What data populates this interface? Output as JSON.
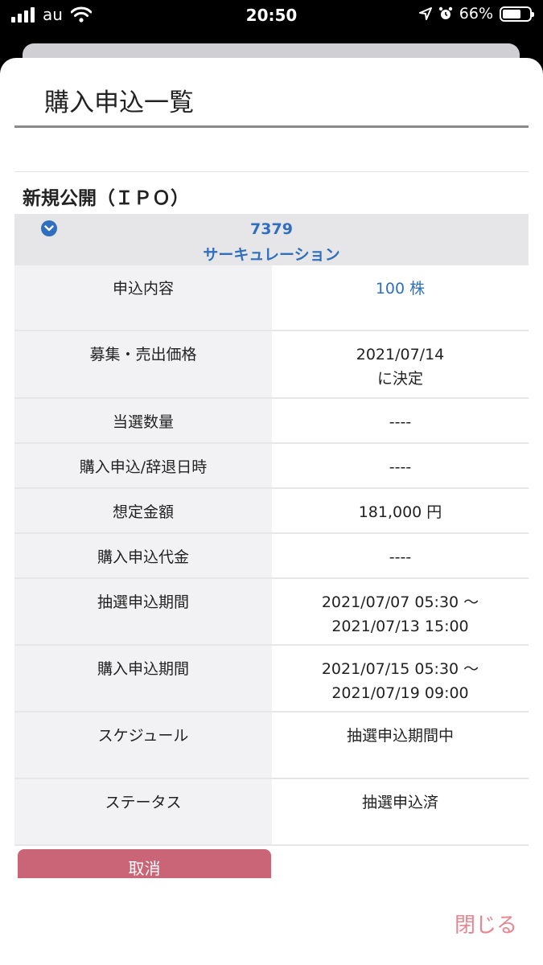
{
  "status_bar": {
    "carrier": "au",
    "time": "20:50",
    "battery_percent": "66%",
    "battery_level": 0.66
  },
  "sheet": {
    "title": "購入申込一覧",
    "section_heading": "新規公開（ＩＰＯ）",
    "stock": {
      "code": "7379",
      "name": "サーキュレーション"
    },
    "rows": [
      {
        "label": "申込内容",
        "value": "100 株",
        "value2": "",
        "accent": true
      },
      {
        "label": "募集・売出価格",
        "value": "2021/07/14",
        "value2": "に決定",
        "accent": false
      },
      {
        "label": "当選数量",
        "value": "----",
        "value2": "",
        "accent": false
      },
      {
        "label": "購入申込/辞退日時",
        "value": "----",
        "value2": "",
        "accent": false
      },
      {
        "label": "想定金額",
        "value": "181,000 円",
        "value2": "",
        "accent": false
      },
      {
        "label": "購入申込代金",
        "value": "----",
        "value2": "",
        "accent": false
      },
      {
        "label": "抽選申込期間",
        "value": "2021/07/07 05:30 〜",
        "value2": "2021/07/13 15:00",
        "accent": false
      },
      {
        "label": "購入申込期間",
        "value": "2021/07/15 05:30 〜",
        "value2": "2021/07/19 09:00",
        "accent": false
      },
      {
        "label": "スケジュール",
        "value": "抽選申込期間中",
        "value2": "",
        "accent": false
      },
      {
        "label": "ステータス",
        "value": "抽選申込済",
        "value2": "",
        "accent": false
      }
    ],
    "cancel_label": "取消",
    "close_label": "閉じる"
  },
  "colors": {
    "accent_blue": "#2f6fbd",
    "cancel_red": "#c96576",
    "close_pink": "#e8858f"
  }
}
